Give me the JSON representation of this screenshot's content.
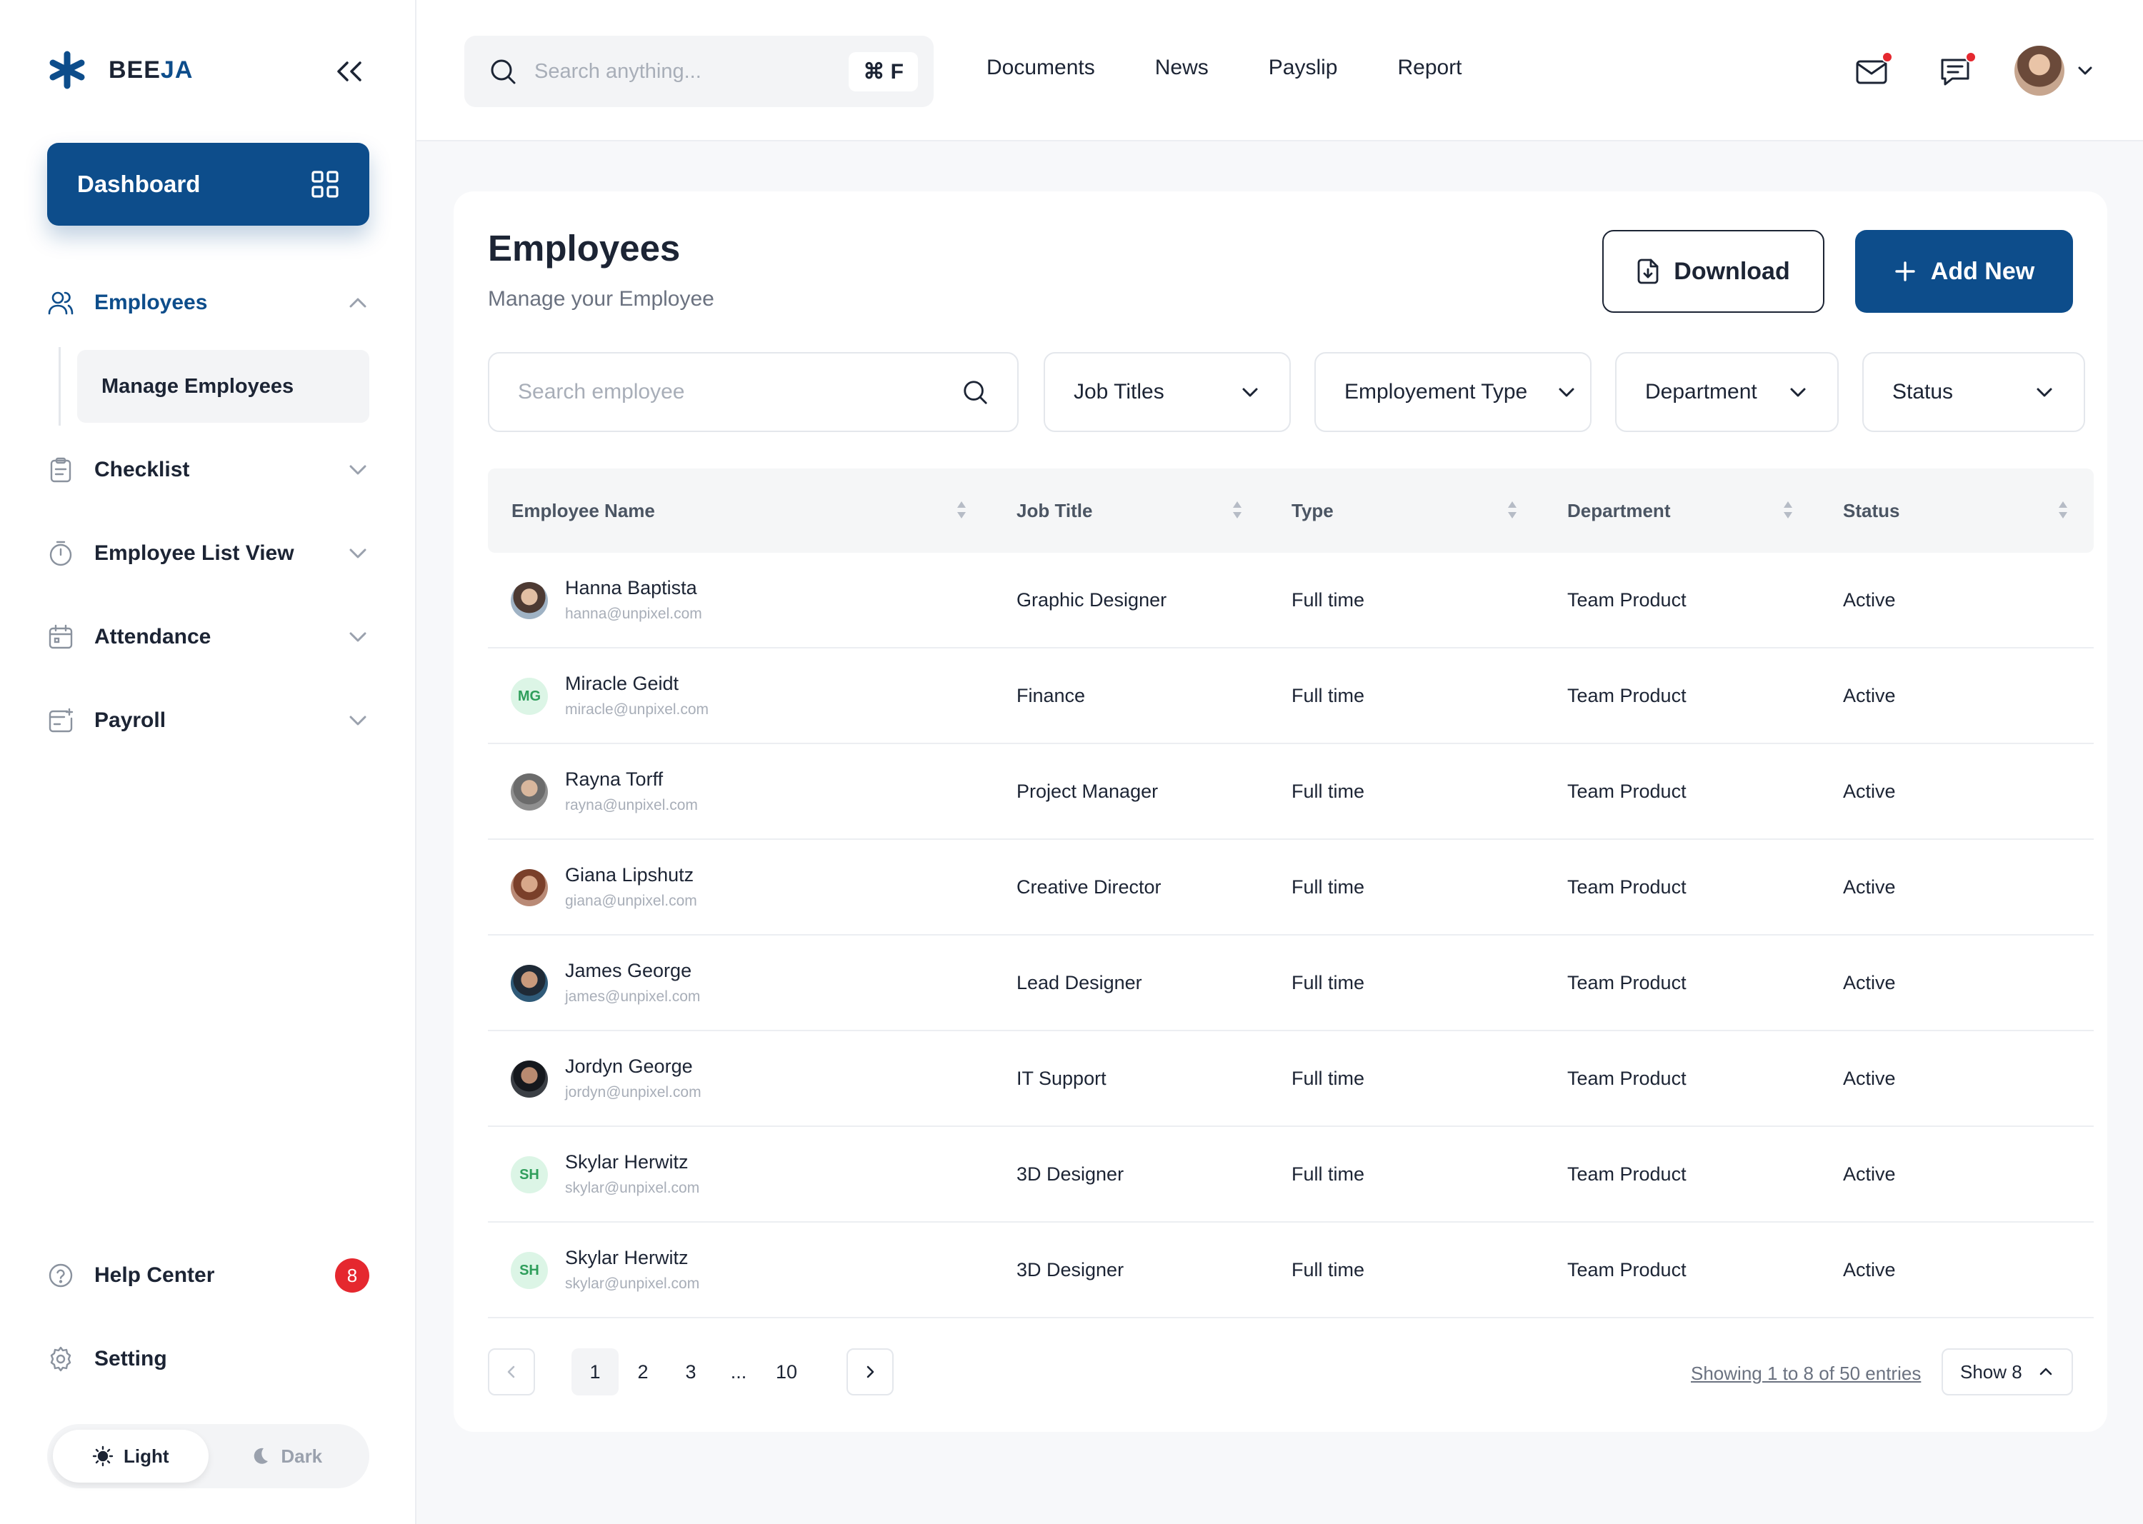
{
  "brand": {
    "name_main": "BEE",
    "name_accent": "JA"
  },
  "sidebar": {
    "dashboard": "Dashboard",
    "items": [
      {
        "label": "Employees",
        "icon": "users-icon",
        "expanded": true
      },
      {
        "label": "Checklist",
        "icon": "clipboard-icon"
      },
      {
        "label": "Employee List View",
        "icon": "timer-icon"
      },
      {
        "label": "Attendance",
        "icon": "calendar-icon"
      },
      {
        "label": "Payroll",
        "icon": "payroll-icon"
      }
    ],
    "sub_item": "Manage Employees",
    "help": {
      "label": "Help Center",
      "badge": "8"
    },
    "setting": "Setting",
    "theme": {
      "light": "Light",
      "dark": "Dark",
      "selected": "Light"
    }
  },
  "topbar": {
    "search_placeholder": "Search anything...",
    "shortcut": "⌘ F",
    "nav": [
      "Documents",
      "News",
      "Payslip",
      "Report"
    ]
  },
  "page": {
    "title": "Employees",
    "subtitle": "Manage your Employee",
    "download": "Download",
    "add_new": "Add New",
    "search_placeholder": "Search employee",
    "filters": [
      "Job Titles",
      "Employement Type",
      "Department",
      "Status"
    ]
  },
  "table": {
    "columns": [
      "Employee Name",
      "Job Title",
      "Type",
      "Department",
      "Status"
    ],
    "rows": [
      {
        "name": "Hanna Baptista",
        "email": "hanna@unpixel.com",
        "job": "Graphic Designer",
        "type": "Full time",
        "dept": "Team Product",
        "status": "Active",
        "avatar": "photo"
      },
      {
        "name": "Miracle Geidt",
        "email": "miracle@unpixel.com",
        "job": "Finance",
        "type": "Full time",
        "dept": "Team Product",
        "status": "Active",
        "avatar": "MG"
      },
      {
        "name": "Rayna Torff",
        "email": "rayna@unpixel.com",
        "job": "Project Manager",
        "type": "Full time",
        "dept": "Team Product",
        "status": "Active",
        "avatar": "photo"
      },
      {
        "name": "Giana Lipshutz",
        "email": "giana@unpixel.com",
        "job": "Creative Director",
        "type": "Full time",
        "dept": "Team Product",
        "status": "Active",
        "avatar": "photo"
      },
      {
        "name": "James George",
        "email": "james@unpixel.com",
        "job": "Lead Designer",
        "type": "Full time",
        "dept": "Team Product",
        "status": "Active",
        "avatar": "photo"
      },
      {
        "name": "Jordyn George",
        "email": "jordyn@unpixel.com",
        "job": "IT Support",
        "type": "Full time",
        "dept": "Team Product",
        "status": "Active",
        "avatar": "photo"
      },
      {
        "name": "Skylar Herwitz",
        "email": "skylar@unpixel.com",
        "job": "3D Designer",
        "type": "Full time",
        "dept": "Team Product",
        "status": "Active",
        "avatar": "SH"
      },
      {
        "name": "Skylar Herwitz",
        "email": "skylar@unpixel.com",
        "job": "3D Designer",
        "type": "Full time",
        "dept": "Team Product",
        "status": "Active",
        "avatar": "SH"
      }
    ]
  },
  "pagination": {
    "pages": [
      "1",
      "2",
      "3",
      "...",
      "10"
    ],
    "current": "1",
    "showing": "Showing 1 to 8 of 50 entries",
    "show": "Show 8"
  },
  "colors": {
    "primary": "#0d4d8b",
    "badge": "#e5282f",
    "initials_bg": "#dcf5e6",
    "initials_fg": "#2f9e5b"
  }
}
